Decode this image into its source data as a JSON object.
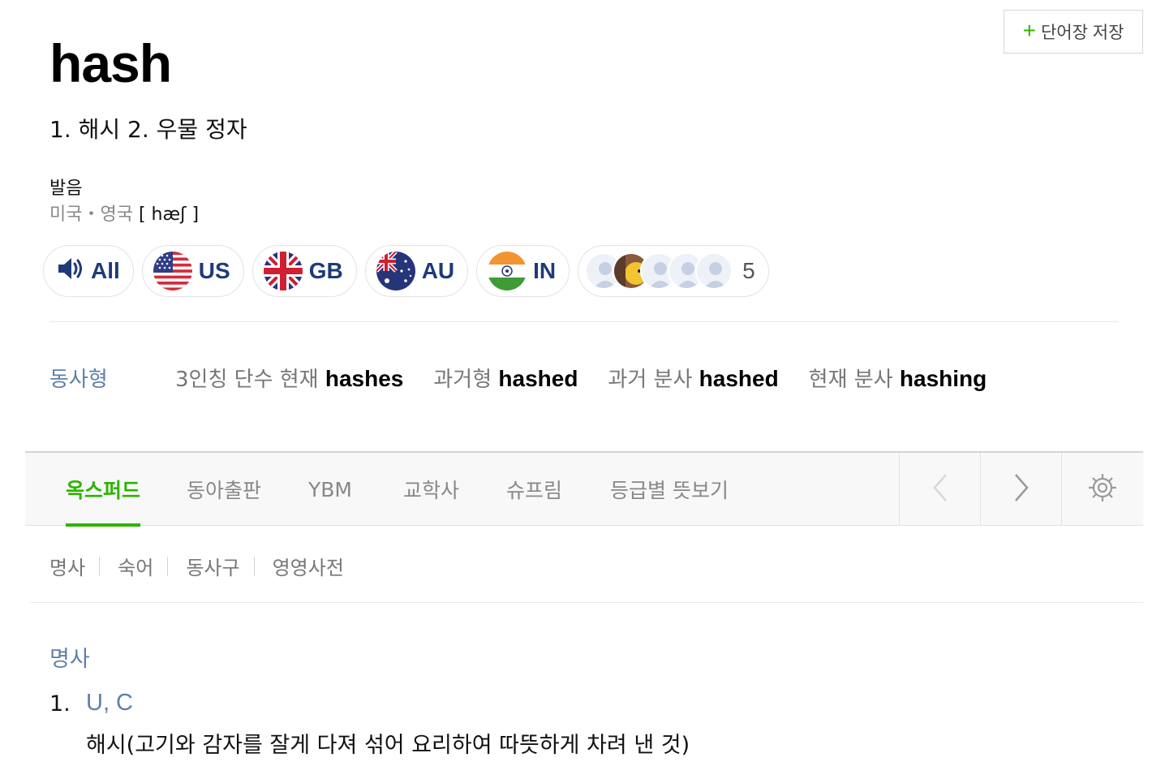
{
  "save_button": {
    "label": "단어장 저장",
    "icon": "plus-icon"
  },
  "entry": {
    "headword": "hash",
    "meanings": "1. 해시 2. 우물 정자"
  },
  "pronunciation": {
    "title": "발음",
    "region": "미국・영국",
    "ipa": "[ hæʃ ]",
    "buttons": [
      {
        "label": "All",
        "icon": "speaker-icon"
      },
      {
        "label": "US",
        "icon": "us-flag-icon"
      },
      {
        "label": "GB",
        "icon": "gb-flag-icon"
      },
      {
        "label": "AU",
        "icon": "au-flag-icon"
      },
      {
        "label": "IN",
        "icon": "in-flag-icon"
      }
    ],
    "user_count": "5"
  },
  "verb_forms": {
    "label": "동사형",
    "items": [
      {
        "name": "3인칭 단수 현재",
        "word": "hashes"
      },
      {
        "name": "과거형",
        "word": "hashed"
      },
      {
        "name": "과거 분사",
        "word": "hashed"
      },
      {
        "name": "현재 분사",
        "word": "hashing"
      }
    ]
  },
  "dictionary_tabs": [
    {
      "label": "옥스퍼드",
      "active": true
    },
    {
      "label": "동아출판",
      "active": false
    },
    {
      "label": "YBM",
      "active": false
    },
    {
      "label": "교학사",
      "active": false
    },
    {
      "label": "슈프림",
      "active": false
    },
    {
      "label": "등급별 뜻보기",
      "active": false
    }
  ],
  "pos_links": [
    "명사",
    "숙어",
    "동사구",
    "영영사전"
  ],
  "section": {
    "pos": "명사",
    "senses": [
      {
        "number": "1.",
        "grammar": "U, C",
        "definition": "해시(고기와 감자를 잘게 다져 섞어 요리하여 따뜻하게 차려 낸 것)"
      }
    ]
  },
  "colors": {
    "accent": "#2db400",
    "link_blue": "#5f7fa8",
    "flag_navy": "#1d3b7a"
  }
}
